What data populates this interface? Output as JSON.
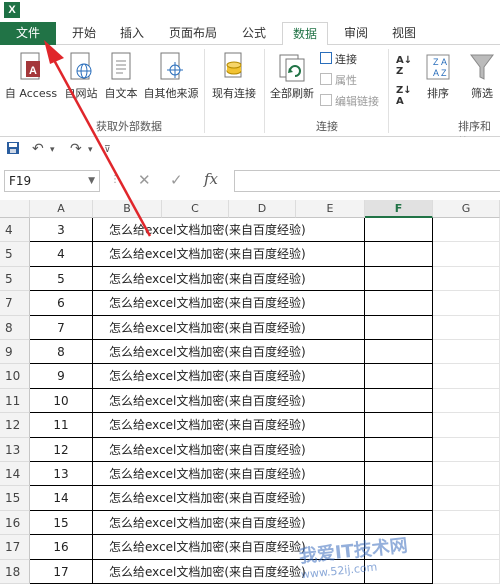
{
  "app": {
    "logo_letter": "X"
  },
  "tabs": [
    {
      "label": "文件"
    },
    {
      "label": "开始"
    },
    {
      "label": "插入"
    },
    {
      "label": "页面布局"
    },
    {
      "label": "公式"
    },
    {
      "label": "数据"
    },
    {
      "label": "审阅"
    },
    {
      "label": "视图"
    }
  ],
  "ribbon": {
    "get_external": {
      "access": "自 Access",
      "web": "自网站",
      "text": "自文本",
      "other": "自其他来源",
      "existing": "现有连接",
      "group_label": "获取外部数据"
    },
    "connections": {
      "refresh_all": "全部刷新",
      "connections": "连接",
      "properties": "属性",
      "edit_links": "编辑链接",
      "group_label": "连接"
    },
    "sort_filter": {
      "sort": "排序",
      "filter": "筛选",
      "group_label": "排序和筛"
    }
  },
  "formula_bar": {
    "name_box": "F19",
    "fx": "fx"
  },
  "columns": [
    "A",
    "B",
    "C",
    "D",
    "E",
    "F",
    "G"
  ],
  "rows": [
    {
      "num": "4",
      "a": "3",
      "b": "怎么给excel文档加密(来自百度经验)"
    },
    {
      "num": "5",
      "a": "4",
      "b": "怎么给excel文档加密(来自百度经验)"
    },
    {
      "num": "5",
      "a": "5",
      "b": "怎么给excel文档加密(来自百度经验)"
    },
    {
      "num": "7",
      "a": "6",
      "b": "怎么给excel文档加密(来自百度经验)"
    },
    {
      "num": "8",
      "a": "7",
      "b": "怎么给excel文档加密(来自百度经验)"
    },
    {
      "num": "9",
      "a": "8",
      "b": "怎么给excel文档加密(来自百度经验)"
    },
    {
      "num": "10",
      "a": "9",
      "b": "怎么给excel文档加密(来自百度经验)"
    },
    {
      "num": "11",
      "a": "10",
      "b": "怎么给excel文档加密(来自百度经验)"
    },
    {
      "num": "12",
      "a": "11",
      "b": "怎么给excel文档加密(来自百度经验)"
    },
    {
      "num": "13",
      "a": "12",
      "b": "怎么给excel文档加密(来自百度经验)"
    },
    {
      "num": "14",
      "a": "13",
      "b": "怎么给excel文档加密(来自百度经验)"
    },
    {
      "num": "15",
      "a": "14",
      "b": "怎么给excel文档加密(来自百度经验)"
    },
    {
      "num": "16",
      "a": "15",
      "b": "怎么给excel文档加密(来自百度经验)"
    },
    {
      "num": "17",
      "a": "16",
      "b": "怎么给excel文档加密(来自百度经验)"
    },
    {
      "num": "18",
      "a": "17",
      "b": "怎么给excel文档加密(来自百度经验)"
    }
  ],
  "watermark": {
    "main": "我爱IT技术网",
    "url": "www.52ij.com"
  },
  "colors": {
    "excel_green": "#217346",
    "annotation_red": "#e0262b"
  }
}
